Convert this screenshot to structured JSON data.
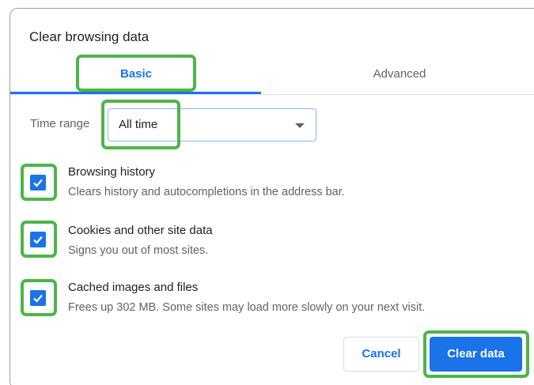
{
  "dialog": {
    "title": "Clear browsing data",
    "tabs": [
      {
        "label": "Basic",
        "active": true
      },
      {
        "label": "Advanced",
        "active": false
      }
    ],
    "time_range": {
      "label": "Time range",
      "value": "All time"
    },
    "items": [
      {
        "title": "Browsing history",
        "description": "Clears history and autocompletions in the address bar.",
        "checked": true
      },
      {
        "title": "Cookies and other site data",
        "description": "Signs you out of most sites.",
        "checked": true
      },
      {
        "title": "Cached images and files",
        "description": "Frees up 302 MB. Some sites may load more slowly on your next visit.",
        "checked": true
      }
    ],
    "buttons": {
      "cancel": "Cancel",
      "clear": "Clear data"
    }
  },
  "colors": {
    "accent": "#1a73e8",
    "highlight": "#4cb648",
    "text_primary": "#202124",
    "text_secondary": "#5f6368"
  }
}
